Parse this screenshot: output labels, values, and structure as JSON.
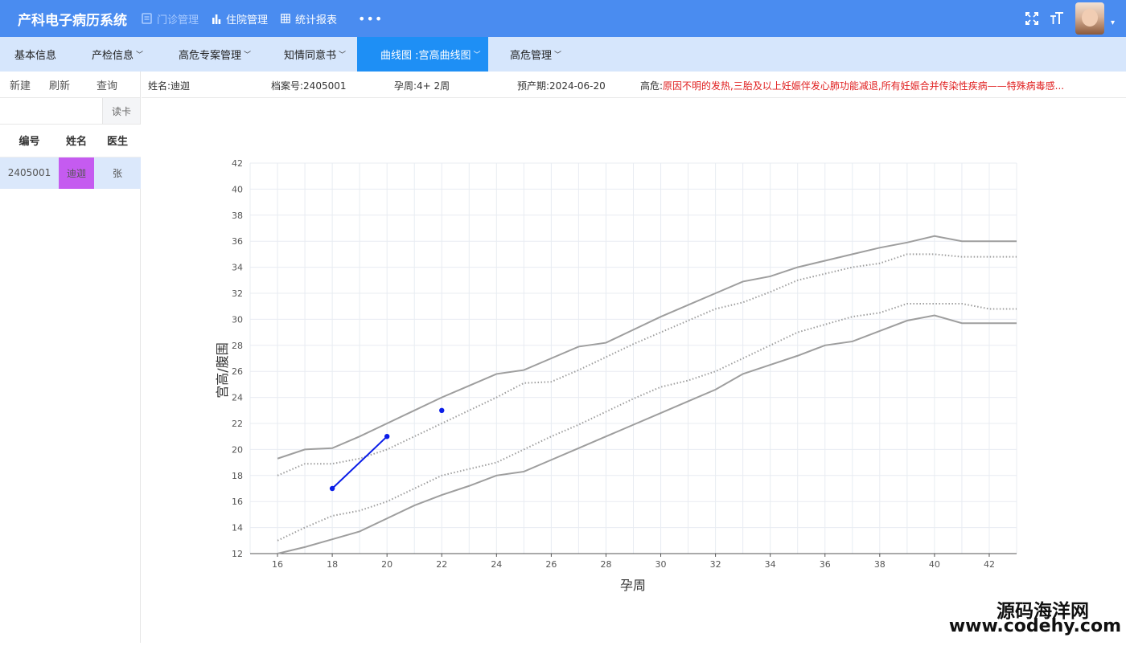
{
  "app": {
    "title": "产科电子病历系统"
  },
  "topnav": [
    {
      "label": "门诊管理",
      "icon": "document-icon",
      "active": true
    },
    {
      "label": "住院管理",
      "icon": "bar-chart-icon",
      "active": false
    },
    {
      "label": "统计报表",
      "icon": "table-icon",
      "active": false
    }
  ],
  "topright": {
    "more": "•••",
    "fullscreen_icon": "fullscreen-icon",
    "fontsize_icon": "font-size-icon",
    "avatar_caret": "▾"
  },
  "tabs": [
    {
      "label": "基本信息",
      "chevron": ""
    },
    {
      "label": "产检信息",
      "chevron": "﹀"
    },
    {
      "label": "高危专案管理",
      "chevron": "﹀"
    },
    {
      "label": "知情同意书",
      "chevron": "﹀"
    },
    {
      "label": "曲线图 :宫高曲线图",
      "chevron": "﹀"
    },
    {
      "label": "高危管理",
      "chevron": "﹀"
    }
  ],
  "leftpanel": {
    "actions": [
      "新建",
      "刷新",
      "查询"
    ],
    "search_placeholder": "",
    "read_card": "读卡",
    "columns": [
      "编号",
      "姓名",
      "医生"
    ],
    "rows": [
      {
        "id": "2405001",
        "name": "迪迦",
        "doctor": "张"
      }
    ]
  },
  "info": {
    "name_label": "姓名:",
    "name": "迪迦",
    "file_label": "档案号:",
    "file_no": "2405001",
    "week_label": "孕周:",
    "week": "4+ 2周",
    "due_label": "预产期:",
    "due": "2024-06-20",
    "risk_label": "高危:",
    "risk": "原因不明的发热,三胎及以上妊娠伴发心肺功能减退,所有妊娠合并传染性疾病——特殊病毒感..."
  },
  "chart_data": {
    "type": "line",
    "title": "",
    "xlabel": "孕周",
    "ylabel": "宫高/腹围",
    "xlim": [
      15,
      43
    ],
    "ylim": [
      12,
      42
    ],
    "xticks": [
      16,
      18,
      20,
      22,
      24,
      26,
      28,
      30,
      32,
      34,
      36,
      38,
      40,
      42
    ],
    "yticks": [
      12,
      14,
      16,
      18,
      20,
      22,
      24,
      26,
      28,
      30,
      32,
      34,
      36,
      38,
      40,
      42
    ],
    "grid": true,
    "series": [
      {
        "style": "solid",
        "color": "#9e9e9e",
        "x": [
          16,
          17,
          18,
          19,
          20,
          21,
          22,
          23,
          24,
          25,
          26,
          27,
          28,
          29,
          30,
          31,
          32,
          33,
          34,
          35,
          36,
          37,
          38,
          39,
          40,
          41,
          42,
          43
        ],
        "y": [
          19.3,
          20,
          20.1,
          21,
          22,
          23,
          24,
          24.9,
          25.8,
          26.1,
          27,
          27.9,
          28.2,
          29.2,
          30.2,
          31.1,
          32,
          32.9,
          33.3,
          34,
          34.5,
          35,
          35.5,
          35.9,
          36.4,
          36,
          36,
          36
        ]
      },
      {
        "style": "dotted",
        "color": "#9e9e9e",
        "x": [
          16,
          17,
          18,
          19,
          20,
          21,
          22,
          23,
          24,
          25,
          26,
          27,
          28,
          29,
          30,
          31,
          32,
          33,
          34,
          35,
          36,
          37,
          38,
          39,
          40,
          41,
          42,
          43
        ],
        "y": [
          18,
          18.9,
          18.9,
          19.3,
          20,
          21,
          22,
          23,
          24,
          25.1,
          25.2,
          26.1,
          27.1,
          28.1,
          29,
          29.9,
          30.8,
          31.3,
          32.1,
          33,
          33.5,
          34,
          34.3,
          35,
          35,
          34.8,
          34.8,
          34.8
        ]
      },
      {
        "style": "dotted",
        "color": "#9e9e9e",
        "x": [
          16,
          17,
          18,
          19,
          20,
          21,
          22,
          23,
          24,
          25,
          26,
          27,
          28,
          29,
          30,
          31,
          32,
          33,
          34,
          35,
          36,
          37,
          38,
          39,
          40,
          41,
          42,
          43
        ],
        "y": [
          13,
          14,
          14.9,
          15.3,
          16,
          17,
          18,
          18.5,
          19,
          20,
          21,
          21.9,
          22.9,
          23.9,
          24.8,
          25.3,
          26,
          27,
          28,
          29,
          29.6,
          30.2,
          30.5,
          31.2,
          31.2,
          31.2,
          30.8,
          30.8
        ]
      },
      {
        "style": "solid",
        "color": "#9e9e9e",
        "x": [
          16,
          17,
          18,
          19,
          20,
          21,
          22,
          23,
          24,
          25,
          26,
          27,
          28,
          29,
          30,
          31,
          32,
          33,
          34,
          35,
          36,
          37,
          38,
          39,
          40,
          41,
          42,
          43
        ],
        "y": [
          12,
          12.5,
          13.1,
          13.7,
          14.7,
          15.7,
          16.5,
          17.2,
          18,
          18.3,
          19.2,
          20.1,
          21,
          21.9,
          22.8,
          23.7,
          24.6,
          25.8,
          26.5,
          27.2,
          28,
          28.3,
          29.1,
          29.9,
          30.3,
          29.7,
          29.7,
          29.7
        ]
      },
      {
        "style": "points",
        "color": "#0a1de8",
        "x": [
          18,
          20
        ],
        "y": [
          17,
          21
        ]
      },
      {
        "style": "points",
        "color": "#0a1de8",
        "x": [
          22
        ],
        "y": [
          23
        ]
      }
    ]
  },
  "watermark": {
    "line1": "源码海洋网",
    "line2": "www.codehy.com"
  }
}
